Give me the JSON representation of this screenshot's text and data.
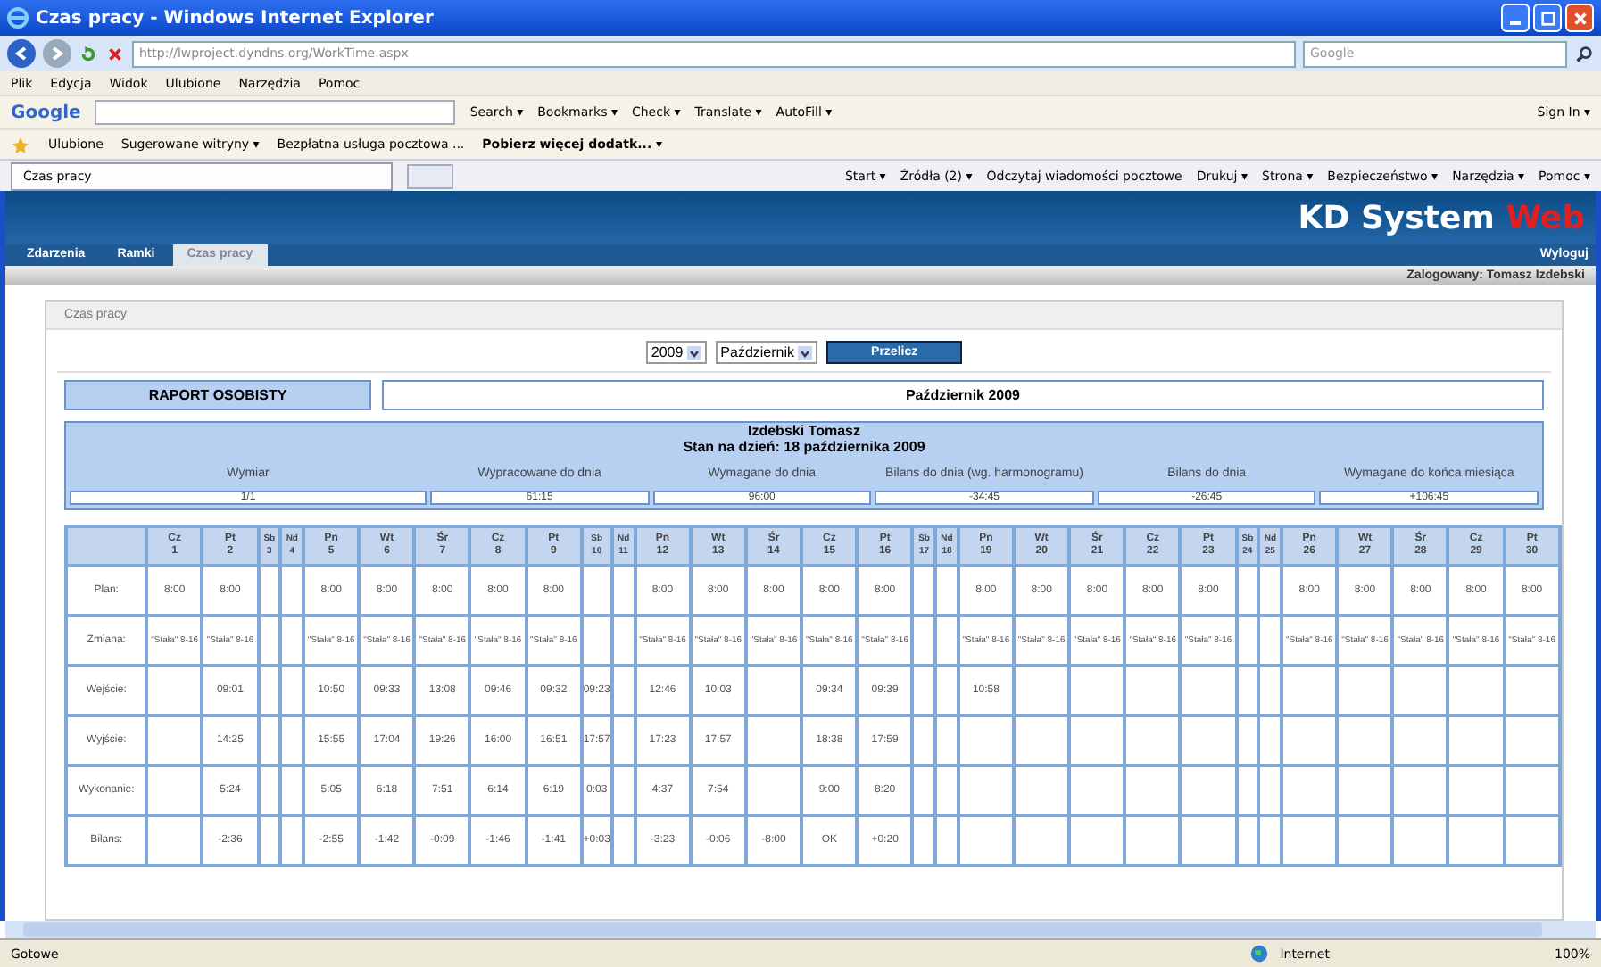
{
  "window": {
    "title": "Czas pracy - Windows Internet Explorer"
  },
  "address_bar": {
    "url": "http://lwproject.dyndns.org/WorkTime.aspx",
    "search_placeholder": "Google"
  },
  "menu": [
    "Plik",
    "Edycja",
    "Widok",
    "Ulubione",
    "Narzędzia",
    "Pomoc"
  ],
  "google_toolbar": {
    "label": "Google",
    "items": [
      "Search ▾",
      "Bookmarks ▾",
      "Check ▾",
      "Translate ▾",
      "AutoFill ▾"
    ],
    "sign_in": "Sign In ▾"
  },
  "favorites_bar": {
    "label": "Ulubione",
    "items": [
      "Sugerowane witryny ▾",
      "Bezpłatna usługa pocztowa ...",
      "Pobierz więcej dodatk... ▾"
    ]
  },
  "browser_tabs": [
    {
      "label": "Czas pracy",
      "selected": true
    }
  ],
  "command_bar": [
    "Start ▾",
    "Źródła (2) ▾",
    "Odczytaj wiadomości pocztowe",
    "Drukuj ▾",
    "Strona ▾",
    "Bezpieczeństwo ▾",
    "Narzędzia ▾",
    "Pomoc ▾"
  ],
  "app": {
    "logo": "KD System",
    "logo_accent": "Web",
    "nav": [
      {
        "label": "Zdarzenia",
        "selected": false
      },
      {
        "label": "Ramki",
        "selected": false
      },
      {
        "label": "Czas pracy",
        "selected": true
      }
    ],
    "logout": "Wyloguj",
    "logged_in": "Zalogowany: Tomasz Izdebski"
  },
  "panel": {
    "title": "Czas pracy",
    "year": "2009",
    "month": "Październik",
    "button": "Przelicz"
  },
  "report": {
    "label": "RAPORT OSOBISTY",
    "period": "Październik 2009",
    "name": "Izdebski   Tomasz",
    "as_of": "Stan na dzień: 18 października 2009",
    "summary": [
      {
        "header": "Wymiar",
        "value": "1/1"
      },
      {
        "header": "Wypracowane do dnia",
        "value": "61:15"
      },
      {
        "header": "Wymagane do dnia",
        "value": "96:00"
      },
      {
        "header": "Bilans do dnia (wg. harmonogramu)",
        "value": "-34:45"
      },
      {
        "header": "Bilans do dnia",
        "value": "-26:45"
      },
      {
        "header": "Wymagane do końca miesiąca",
        "value": "+106:45"
      }
    ]
  },
  "table": {
    "days": [
      {
        "day": "Cz",
        "num": "1",
        "weekend": false
      },
      {
        "day": "Pt",
        "num": "2",
        "weekend": false
      },
      {
        "day": "Sb",
        "num": "3",
        "weekend": true
      },
      {
        "day": "Nd",
        "num": "4",
        "weekend": true
      },
      {
        "day": "Pn",
        "num": "5",
        "weekend": false
      },
      {
        "day": "Wt",
        "num": "6",
        "weekend": false
      },
      {
        "day": "Śr",
        "num": "7",
        "weekend": false
      },
      {
        "day": "Cz",
        "num": "8",
        "weekend": false
      },
      {
        "day": "Pt",
        "num": "9",
        "weekend": false
      },
      {
        "day": "Sb",
        "num": "10",
        "weekend": true
      },
      {
        "day": "Nd",
        "num": "11",
        "weekend": true
      },
      {
        "day": "Pn",
        "num": "12",
        "weekend": false
      },
      {
        "day": "Wt",
        "num": "13",
        "weekend": false
      },
      {
        "day": "Śr",
        "num": "14",
        "weekend": false
      },
      {
        "day": "Cz",
        "num": "15",
        "weekend": false
      },
      {
        "day": "Pt",
        "num": "16",
        "weekend": false
      },
      {
        "day": "Sb",
        "num": "17",
        "weekend": true
      },
      {
        "day": "Nd",
        "num": "18",
        "weekend": true
      },
      {
        "day": "Pn",
        "num": "19",
        "weekend": false
      },
      {
        "day": "Wt",
        "num": "20",
        "weekend": false
      },
      {
        "day": "Śr",
        "num": "21",
        "weekend": false
      },
      {
        "day": "Cz",
        "num": "22",
        "weekend": false
      },
      {
        "day": "Pt",
        "num": "23",
        "weekend": false
      },
      {
        "day": "Sb",
        "num": "24",
        "weekend": true
      },
      {
        "day": "Nd",
        "num": "25",
        "weekend": true
      },
      {
        "day": "Pn",
        "num": "26",
        "weekend": false
      },
      {
        "day": "Wt",
        "num": "27",
        "weekend": false
      },
      {
        "day": "Śr",
        "num": "28",
        "weekend": false
      },
      {
        "day": "Cz",
        "num": "29",
        "weekend": false
      },
      {
        "day": "Pt",
        "num": "30",
        "weekend": false
      }
    ],
    "rows": [
      {
        "label": "Plan:",
        "cells": [
          "8:00",
          "8:00",
          "",
          "",
          "8:00",
          "8:00",
          "8:00",
          "8:00",
          "8:00",
          "",
          "",
          "8:00",
          "8:00",
          "8:00",
          "8:00",
          "8:00",
          "",
          "",
          "8:00",
          "8:00",
          "8:00",
          "8:00",
          "8:00",
          "",
          "",
          "8:00",
          "8:00",
          "8:00",
          "8:00",
          "8:00"
        ]
      },
      {
        "label": "Zmiana:",
        "cells": [
          "\"Stała\" 8-16",
          "\"Stała\" 8-16",
          "",
          "",
          "\"Stała\" 8-16",
          "\"Stała\" 8-16",
          "\"Stała\" 8-16",
          "\"Stała\" 8-16",
          "\"Stała\" 8-16",
          "",
          "",
          "\"Stała\" 8-16",
          "\"Stała\" 8-16",
          "\"Stała\" 8-16",
          "\"Stała\" 8-16",
          "\"Stała\" 8-16",
          "",
          "",
          "\"Stała\" 8-16",
          "\"Stała\" 8-16",
          "\"Stała\" 8-16",
          "\"Stała\" 8-16",
          "\"Stała\" 8-16",
          "",
          "",
          "\"Stała\" 8-16",
          "\"Stała\" 8-16",
          "\"Stała\" 8-16",
          "\"Stała\" 8-16",
          "\"Stała\" 8-16"
        ]
      },
      {
        "label": "Wejście:",
        "cells": [
          "",
          "09:01",
          "",
          "",
          "10:50",
          "09:33",
          "13:08",
          "09:46",
          "09:32",
          "09:23",
          "",
          "12:46",
          "10:03",
          "",
          "09:34",
          "09:39",
          "",
          "",
          "10:58",
          "",
          "",
          "",
          "",
          "",
          "",
          "",
          "",
          "",
          "",
          ""
        ]
      },
      {
        "label": "Wyjście:",
        "cells": [
          "",
          "14:25",
          "",
          "",
          "15:55",
          "17:04",
          "19:26",
          "16:00",
          "16:51",
          "17:57",
          "",
          "17:23",
          "17:57",
          "",
          "18:38",
          "17:59",
          "",
          "",
          "",
          "",
          "",
          "",
          "",
          "",
          "",
          "",
          "",
          "",
          "",
          ""
        ]
      },
      {
        "label": "Wykonanie:",
        "cells": [
          "",
          "5:24",
          "",
          "",
          "5:05",
          "6:18",
          "7:51",
          "6:14",
          "6:19",
          "0:03",
          "",
          "4:37",
          "7:54",
          "",
          "9:00",
          "8:20",
          "",
          "",
          "",
          "",
          "",
          "",
          "",
          "",
          "",
          "",
          "",
          "",
          "",
          ""
        ]
      },
      {
        "label": "Bilans:",
        "cells": [
          "",
          "-2:36",
          "",
          "",
          "-2:55",
          "-1:42",
          "-0:09",
          "-1:46",
          "-1:41",
          "+0:03",
          "",
          "-3:23",
          "-0:06",
          "-8:00",
          "OK",
          "+0:20",
          "",
          "",
          "",
          "",
          "",
          "",
          "",
          "",
          "",
          "",
          "",
          "",
          "",
          ""
        ]
      }
    ]
  },
  "status_bar": {
    "text": "Gotowe",
    "zone": "Internet",
    "zoom": "100%"
  }
}
